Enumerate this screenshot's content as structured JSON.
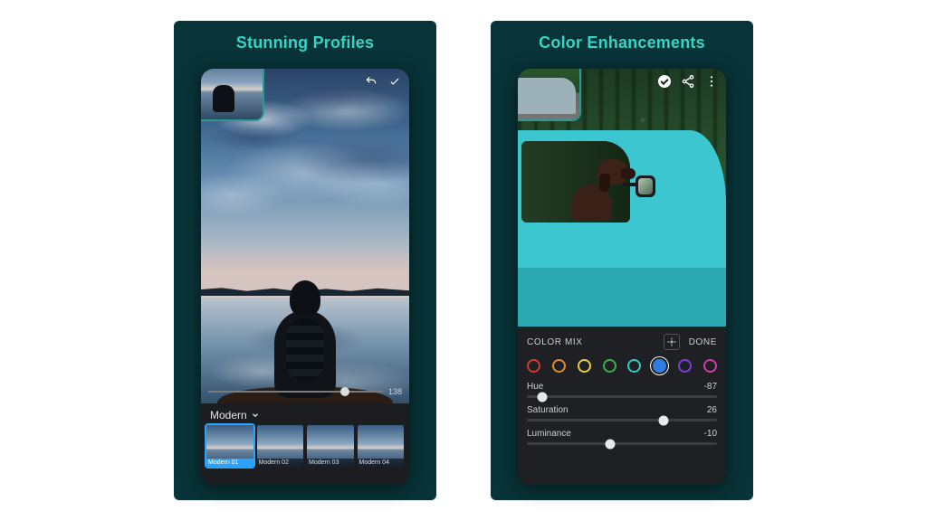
{
  "left": {
    "title": "Stunning Profiles",
    "profile_strip": {
      "category": "Modern",
      "slider_value": "138",
      "items": [
        {
          "label": "Modern 01",
          "selected": true
        },
        {
          "label": "Modern 02",
          "selected": false
        },
        {
          "label": "Modern 03",
          "selected": false
        },
        {
          "label": "Modern 04",
          "selected": false
        }
      ]
    },
    "icons": {
      "undo": "undo-icon",
      "confirm": "check-icon"
    }
  },
  "right": {
    "title": "Color Enhancements",
    "topbar": {
      "confirm": "circle-check-icon",
      "share": "share-icon",
      "more": "more-icon"
    },
    "editor": {
      "section_label": "COLOR MIX",
      "target_label": "target-icon",
      "done_label": "DONE",
      "swatches": [
        {
          "name": "red",
          "color": "#d33a2f",
          "selected": false
        },
        {
          "name": "orange",
          "color": "#e08a2c",
          "selected": false
        },
        {
          "name": "yellow",
          "color": "#e2cf3a",
          "selected": false
        },
        {
          "name": "green",
          "color": "#3fae4f",
          "selected": false
        },
        {
          "name": "aqua",
          "color": "#3bc6c0",
          "selected": false
        },
        {
          "name": "blue",
          "color": "#2f7de0",
          "selected": true
        },
        {
          "name": "purple",
          "color": "#7a3fd0",
          "selected": false
        },
        {
          "name": "magenta",
          "color": "#cc3fa7",
          "selected": false
        }
      ],
      "sliders": [
        {
          "name": "Hue",
          "value": -87,
          "pos": 8
        },
        {
          "name": "Saturation",
          "value": 26,
          "pos": 72
        },
        {
          "name": "Luminance",
          "value": -10,
          "pos": 44
        }
      ]
    }
  }
}
